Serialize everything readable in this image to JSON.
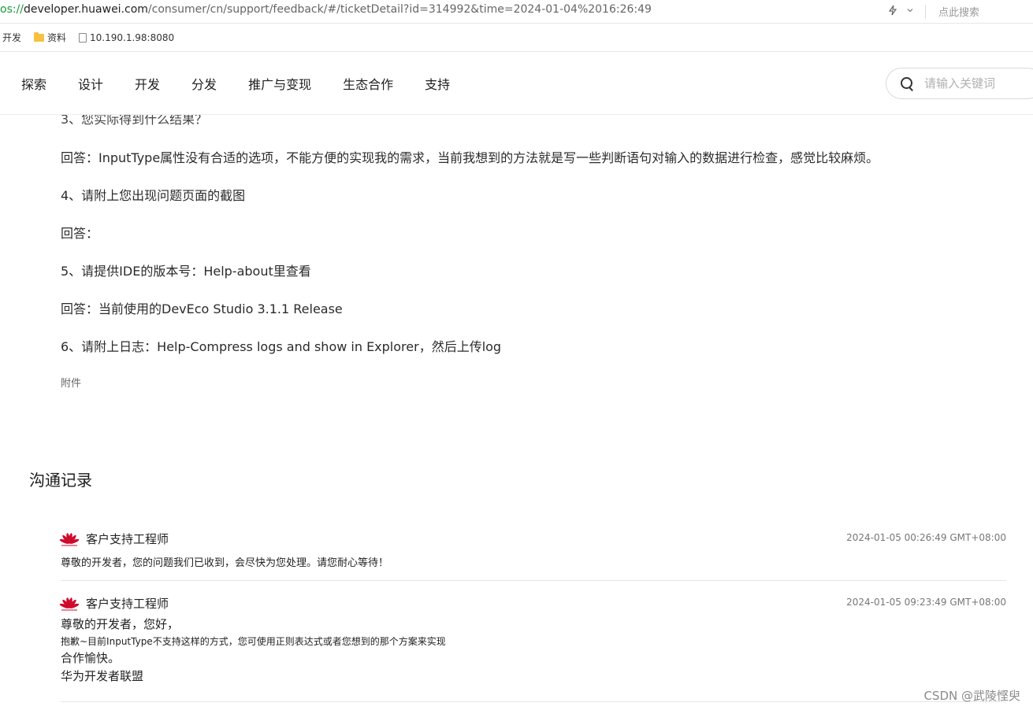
{
  "browser": {
    "url_scheme": "os://",
    "url_host": "developer.huawei.com",
    "url_path": "/consumer/cn/support/feedback/#/ticketDetail?id=314992&time=2024-01-04%2016:26:49",
    "search_label": "点此搜索",
    "icons": [
      "lightning-icon",
      "chevron-down-icon"
    ]
  },
  "bookmarks": [
    {
      "label": "开发",
      "icon": "none"
    },
    {
      "label": "资料",
      "icon": "folder-icon"
    },
    {
      "label": "10.190.1.98:8080",
      "icon": "page-icon"
    }
  ],
  "nav": {
    "items": [
      "探索",
      "设计",
      "开发",
      "分发",
      "推广与变现",
      "生态合作",
      "支持"
    ],
    "search_placeholder": "请输入关键词"
  },
  "ticket": {
    "q3_partial": "3、您实际得到什么结果？",
    "a3": "回答：InputType属性没有合适的选项，不能方便的实现我的需求，当前我想到的方法就是写一些判断语句对输入的数据进行检查，感觉比较麻烦。",
    "q4": "4、请附上您出现问题页面的截图",
    "a4": "回答：",
    "q5": "5、请提供IDE的版本号：Help-about里查看",
    "a5": "回答：当前使用的DevEco Studio 3.1.1 Release",
    "q6": "6、请附上日志：Help-Compress logs and show in Explorer，然后上传log",
    "attachment_label": "附件"
  },
  "records": {
    "title": "沟通记录",
    "items": [
      {
        "author": "客户支持工程师",
        "time": "2024-01-05 00:26:49 GMT+08:00",
        "message": "尊敬的开发者，您的问题我们已收到，会尽快为您处理。请您耐心等待！"
      },
      {
        "author": "客户支持工程师",
        "time": "2024-01-05 09:23:49 GMT+08:00",
        "line1": "尊敬的开发者，您好，",
        "line2": "抱歉~目前InputType不支持这样的方式，您可使用正则表达式或者您想到的那个方案来实现",
        "line3": "合作愉快。",
        "line4": "华为开发者联盟"
      }
    ]
  },
  "watermark": "CSDN @武陵悭臾"
}
